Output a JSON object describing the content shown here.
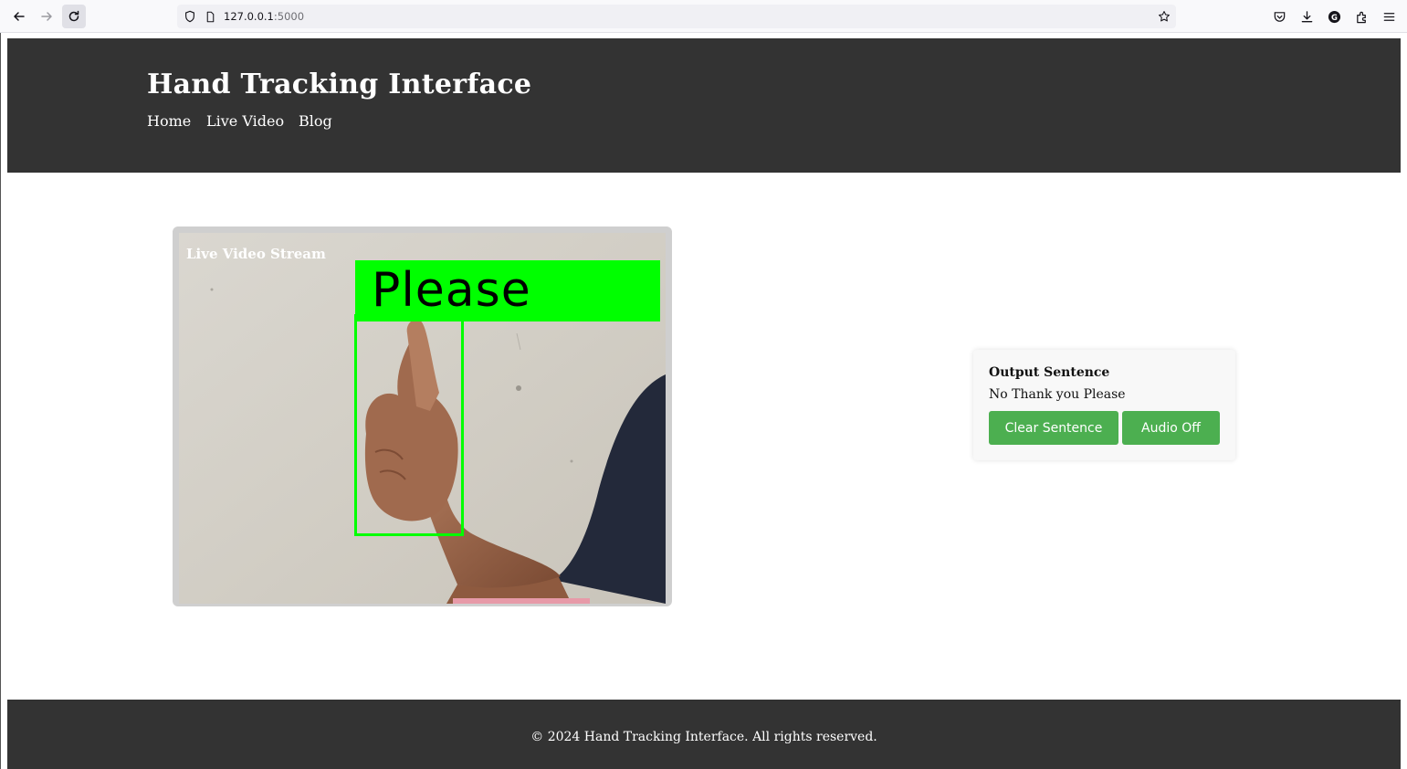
{
  "browser": {
    "url_host": "127.0.0.1",
    "url_port": ":5000"
  },
  "header": {
    "title": "Hand Tracking Interface",
    "nav": [
      "Home",
      "Live Video",
      "Blog"
    ]
  },
  "video": {
    "label": "Live Video Stream",
    "detection_label": "Please",
    "detection_color": "#00ff00"
  },
  "output": {
    "title": "Output Sentence",
    "sentence": "No Thank you Please",
    "clear_button": "Clear Sentence",
    "audio_button": "Audio Off",
    "button_color": "#4caf50"
  },
  "footer": {
    "text": "© 2024 Hand Tracking Interface. All rights reserved."
  },
  "theme": {
    "header_bg": "#333333"
  }
}
